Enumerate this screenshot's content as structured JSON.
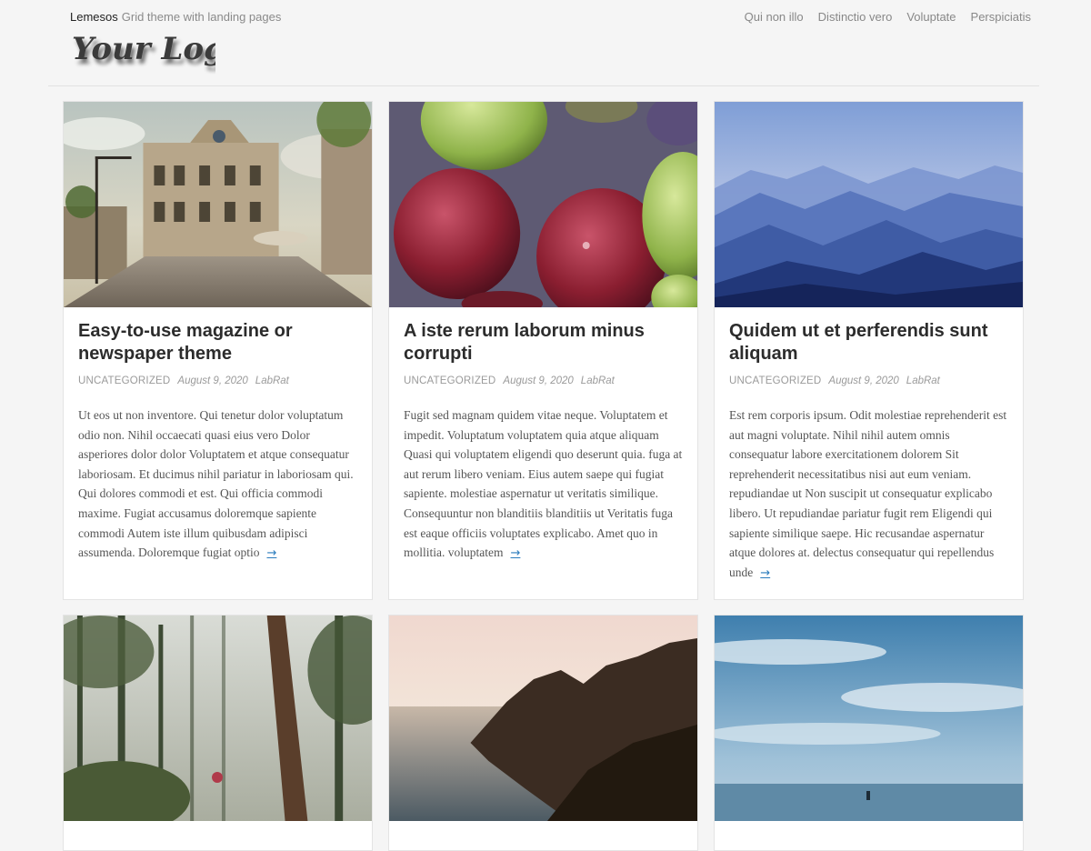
{
  "header": {
    "site_name": "Lemesos",
    "site_description": "Grid theme with landing pages",
    "logo_text": "Your Logo"
  },
  "nav": {
    "items": [
      {
        "label": "Qui non illo"
      },
      {
        "label": "Distinctio vero"
      },
      {
        "label": "Voluptate"
      },
      {
        "label": "Perspiciatis"
      }
    ]
  },
  "posts": [
    {
      "title": "Easy-to-use magazine or newspaper theme",
      "category": "UNCATEGORIZED",
      "date": "August 9, 2020",
      "author": "LabRat",
      "excerpt": "Ut eos ut non inventore. Qui tenetur dolor voluptatum odio non. Nihil occaecati quasi eius vero Dolor asperiores dolor dolor Voluptatem et atque consequatur laboriosam. Et ducimus nihil pariatur in laboriosam qui. Qui dolores commodi et est. Qui officia commodi maxime. Fugiat accusamus doloremque sapiente commodi Autem iste illum quibusdam adipisci assumenda. Doloremque fugiat optio",
      "more_arrow": "→",
      "image": "city-street-building"
    },
    {
      "title": "A iste rerum laborum minus corrupti",
      "category": "UNCATEGORIZED",
      "date": "August 9, 2020",
      "author": "LabRat",
      "excerpt": "Fugit sed magnam quidem vitae neque. Voluptatem et impedit. Voluptatum voluptatem quia atque aliquam Quasi qui voluptatem eligendi quo deserunt quia. fuga at aut rerum libero veniam. Eius autem saepe qui fugiat sapiente. molestiae aspernatur ut veritatis similique. Consequuntur non blanditiis blanditiis ut Veritatis fuga est eaque officiis voluptates explicabo. Amet quo in mollitia. voluptatem",
      "more_arrow": "→",
      "image": "figs-on-purple"
    },
    {
      "title": "Quidem ut et perferendis sunt aliquam",
      "category": "UNCATEGORIZED",
      "date": "August 9, 2020",
      "author": "LabRat",
      "excerpt": "Est rem corporis ipsum. Odit molestiae reprehenderit est aut magni voluptate. Nihil nihil autem omnis consequatur labore exercitationem dolorem Sit reprehenderit necessitatibus nisi aut eum veniam. repudiandae ut Non suscipit ut consequatur explicabo libero. Ut repudiandae pariatur fugit rem Eligendi qui sapiente similique saepe. Hic recusandae aspernatur atque dolores at. delectus consequatur qui repellendus unde",
      "more_arrow": "→",
      "image": "blue-mountains"
    },
    {
      "image": "misty-forest"
    },
    {
      "image": "sea-cliff-sunset"
    },
    {
      "image": "sky-over-sea"
    }
  ],
  "colors": {
    "background": "#f5f5f5",
    "card": "#ffffff",
    "accent": "#2a7bbd",
    "title": "#2c2c2c",
    "meta": "#9a9a9a"
  }
}
